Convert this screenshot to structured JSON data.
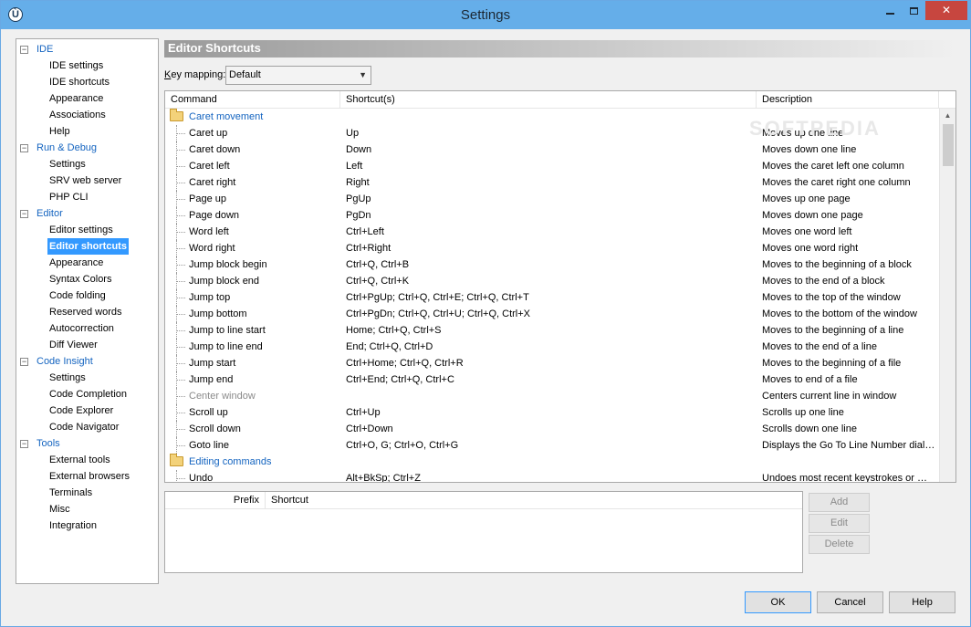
{
  "window": {
    "title": "Settings",
    "app_icon_glyph": "Ù",
    "close_glyph": "✕"
  },
  "tree": {
    "groups": [
      {
        "label": "IDE",
        "children": [
          "IDE settings",
          "IDE shortcuts",
          "Appearance",
          "Associations",
          "Help"
        ]
      },
      {
        "label": "Run & Debug",
        "children": [
          "Settings",
          "SRV web server",
          "PHP CLI"
        ]
      },
      {
        "label": "Editor",
        "children": [
          "Editor settings",
          "Editor shortcuts",
          "Appearance",
          "Syntax Colors",
          "Code folding",
          "Reserved words",
          "Autocorrection",
          "Diff Viewer"
        ]
      },
      {
        "label": "Code Insight",
        "children": [
          "Settings",
          "Code Completion",
          "Code Explorer",
          "Code Navigator"
        ]
      },
      {
        "label": "Tools",
        "children": [
          "External tools",
          "External browsers",
          "Terminals",
          "Misc",
          "Integration"
        ]
      }
    ],
    "selected": "Editor shortcuts",
    "expander_glyph": "−"
  },
  "panel": {
    "title": "Editor Shortcuts",
    "keymap_label_prefix": "K",
    "keymap_label_rest": "ey mapping:",
    "keymap_value": "Default",
    "dropdown_arrow": "▼"
  },
  "grid": {
    "columns": [
      "Command",
      "Shortcut(s)",
      "Description"
    ],
    "scroll_up_glyph": "▲",
    "watermark": "SOFTPEDIA",
    "rows": [
      {
        "type": "category",
        "command": "Caret movement",
        "shortcut": "",
        "description": ""
      },
      {
        "type": "item",
        "command": "Caret up",
        "shortcut": "Up",
        "description": "Moves up one line"
      },
      {
        "type": "item",
        "command": "Caret down",
        "shortcut": "Down",
        "description": "Moves down one line"
      },
      {
        "type": "item",
        "command": "Caret left",
        "shortcut": "Left",
        "description": "Moves the caret left one column"
      },
      {
        "type": "item",
        "command": "Caret right",
        "shortcut": "Right",
        "description": "Moves the caret right one column"
      },
      {
        "type": "item",
        "command": "Page up",
        "shortcut": "PgUp",
        "description": "Moves up one page"
      },
      {
        "type": "item",
        "command": "Page down",
        "shortcut": "PgDn",
        "description": "Moves down one page"
      },
      {
        "type": "item",
        "command": "Word left",
        "shortcut": "Ctrl+Left",
        "description": "Moves one word left"
      },
      {
        "type": "item",
        "command": "Word right",
        "shortcut": "Ctrl+Right",
        "description": "Moves one word right"
      },
      {
        "type": "item",
        "command": "Jump block begin",
        "shortcut": "Ctrl+Q, Ctrl+B",
        "description": "Moves to the beginning of a block"
      },
      {
        "type": "item",
        "command": "Jump block end",
        "shortcut": "Ctrl+Q, Ctrl+K",
        "description": "Moves to the end of a block"
      },
      {
        "type": "item",
        "command": "Jump top",
        "shortcut": "Ctrl+PgUp; Ctrl+Q, Ctrl+E; Ctrl+Q, Ctrl+T",
        "description": "Moves to the top of the window"
      },
      {
        "type": "item",
        "command": "Jump bottom",
        "shortcut": "Ctrl+PgDn; Ctrl+Q, Ctrl+U; Ctrl+Q, Ctrl+X",
        "description": "Moves to the bottom of the window"
      },
      {
        "type": "item",
        "command": "Jump to line start",
        "shortcut": "Home; Ctrl+Q, Ctrl+S",
        "description": "Moves to the beginning of a line"
      },
      {
        "type": "item",
        "command": "Jump to line end",
        "shortcut": "End; Ctrl+Q, Ctrl+D",
        "description": "Moves to the end of a line"
      },
      {
        "type": "item",
        "command": "Jump start",
        "shortcut": "Ctrl+Home; Ctrl+Q, Ctrl+R",
        "description": "Moves to the beginning of a file"
      },
      {
        "type": "item",
        "command": "Jump end",
        "shortcut": "Ctrl+End; Ctrl+Q, Ctrl+C",
        "description": "Moves to end of a file"
      },
      {
        "type": "disabled",
        "command": "Center window",
        "shortcut": "",
        "description": "Centers current line in window"
      },
      {
        "type": "item",
        "command": "Scroll up",
        "shortcut": "Ctrl+Up",
        "description": "Scrolls up one line"
      },
      {
        "type": "item",
        "command": "Scroll down",
        "shortcut": "Ctrl+Down",
        "description": "Scrolls down one line"
      },
      {
        "type": "item",
        "command": "Goto line",
        "shortcut": "Ctrl+O, G; Ctrl+O, Ctrl+G",
        "description": "Displays the Go To Line Number dialo…"
      },
      {
        "type": "category",
        "command": "Editing commands",
        "shortcut": "",
        "description": ""
      },
      {
        "type": "item",
        "command": "Undo",
        "shortcut": "Alt+BkSp; Ctrl+Z",
        "description": "Undoes most recent keystrokes or m…"
      }
    ]
  },
  "prefix_grid": {
    "columns": [
      "Prefix",
      "Shortcut"
    ]
  },
  "side_buttons": {
    "add": "Add",
    "edit": "Edit",
    "delete": "Delete"
  },
  "dialog_buttons": {
    "ok": "OK",
    "cancel": "Cancel",
    "help": "Help"
  }
}
